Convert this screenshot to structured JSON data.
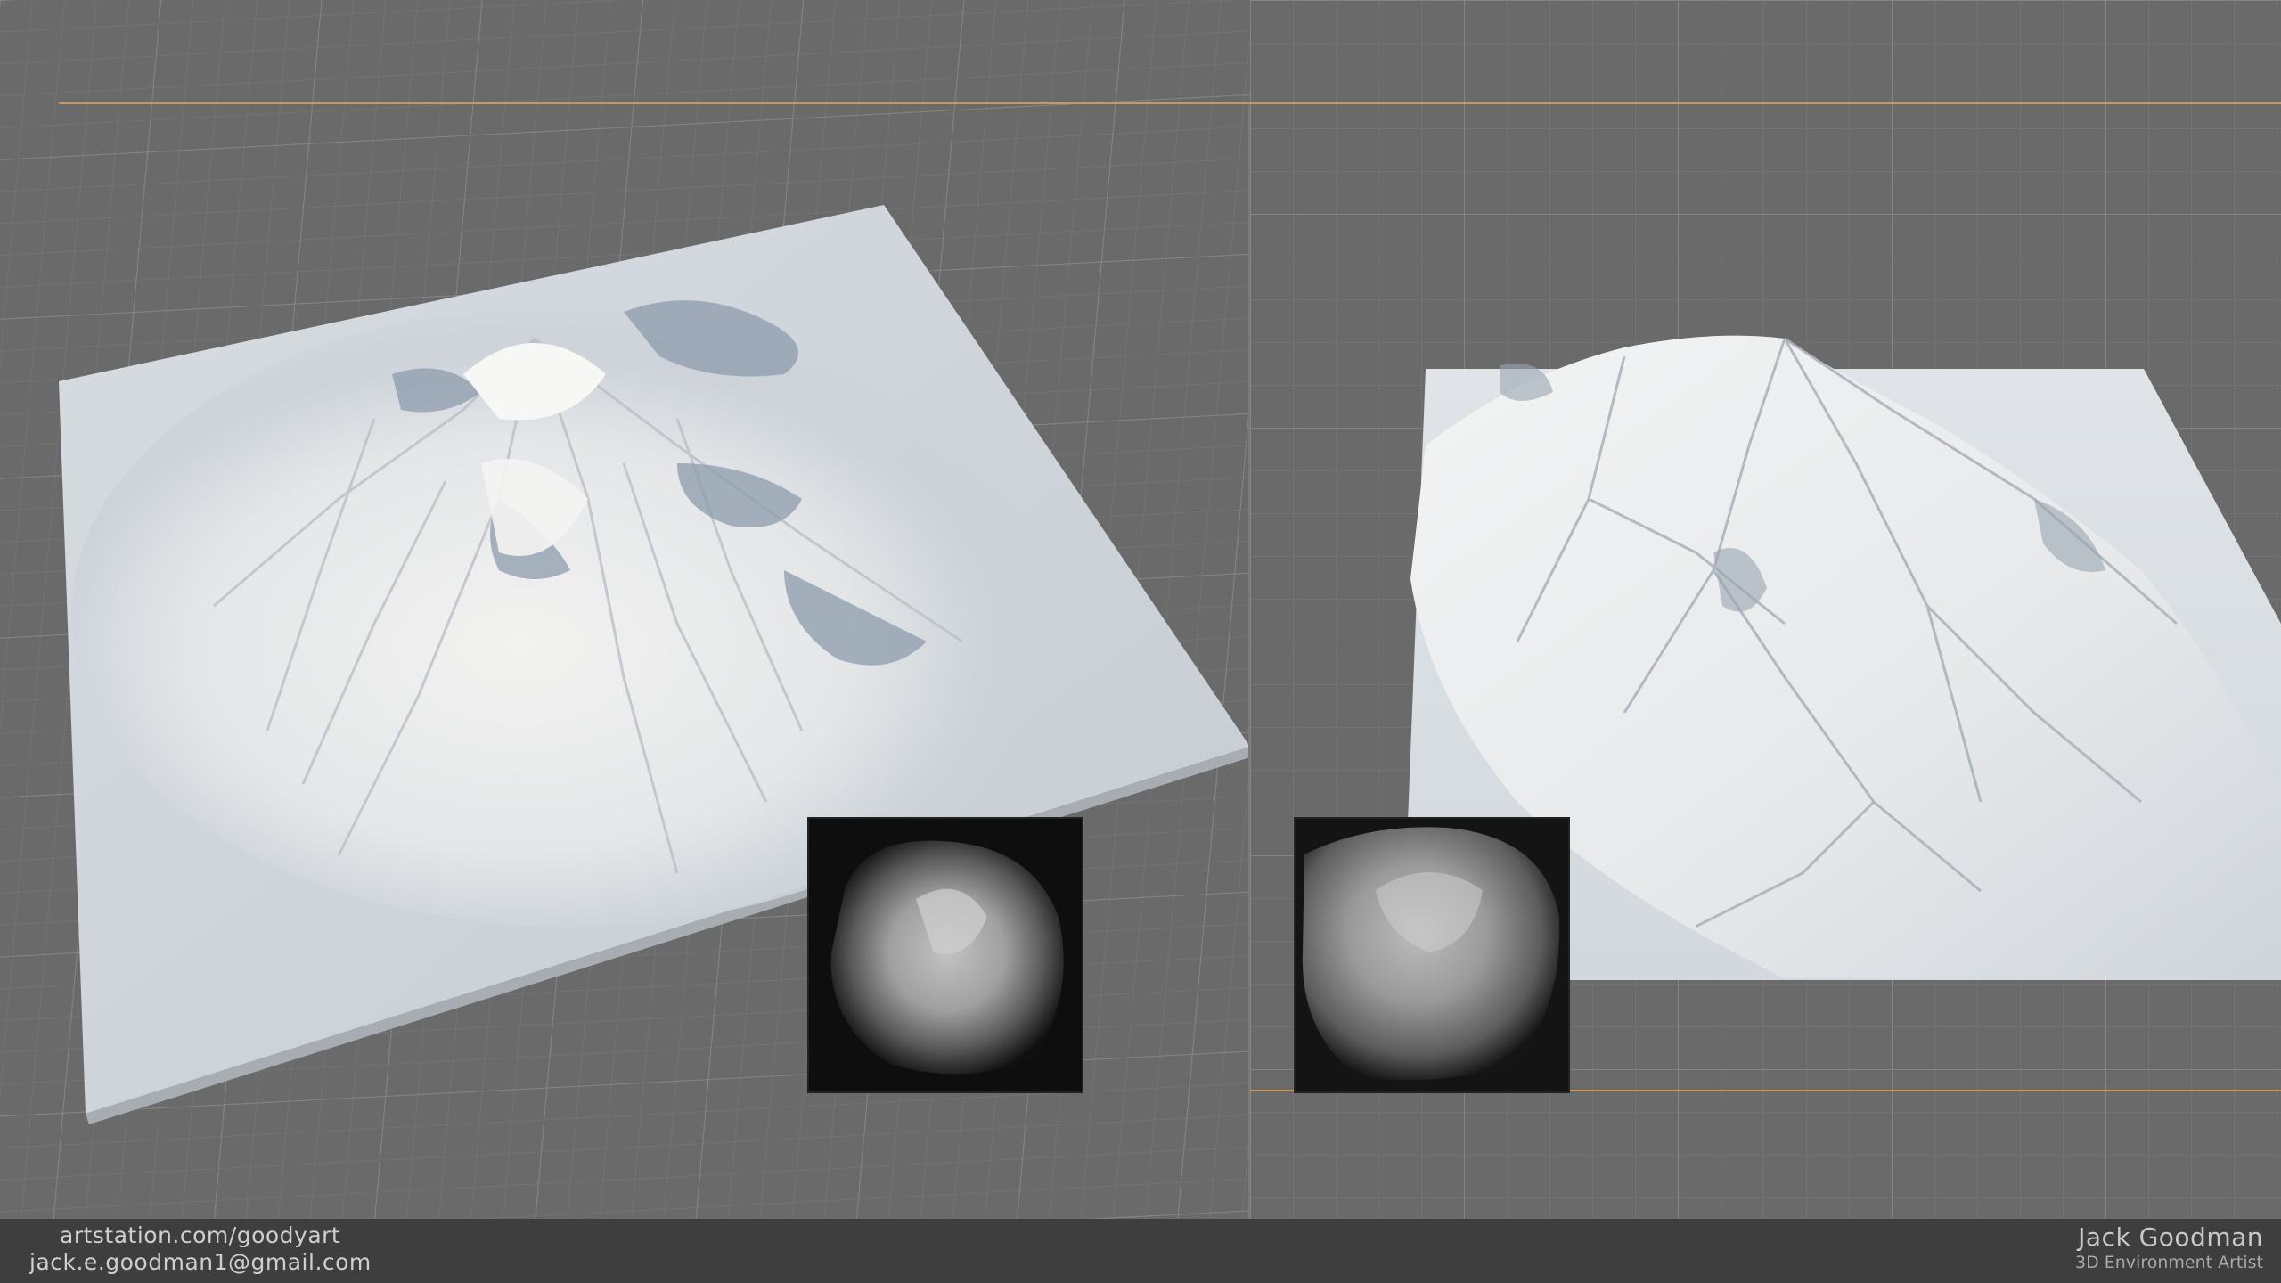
{
  "footer": {
    "website": "artstation.com/goodyart",
    "email": "jack.e.goodman1@gmail.com",
    "artist_name": "Jack Goodman",
    "artist_role": "3D Environment Artist"
  },
  "colors": {
    "background": "#6b6b6b",
    "grid_line": "#7d7d7d",
    "footer": "#3e3e3e",
    "accent_line": "#c89a5a",
    "terrain": "#d8dde2"
  }
}
